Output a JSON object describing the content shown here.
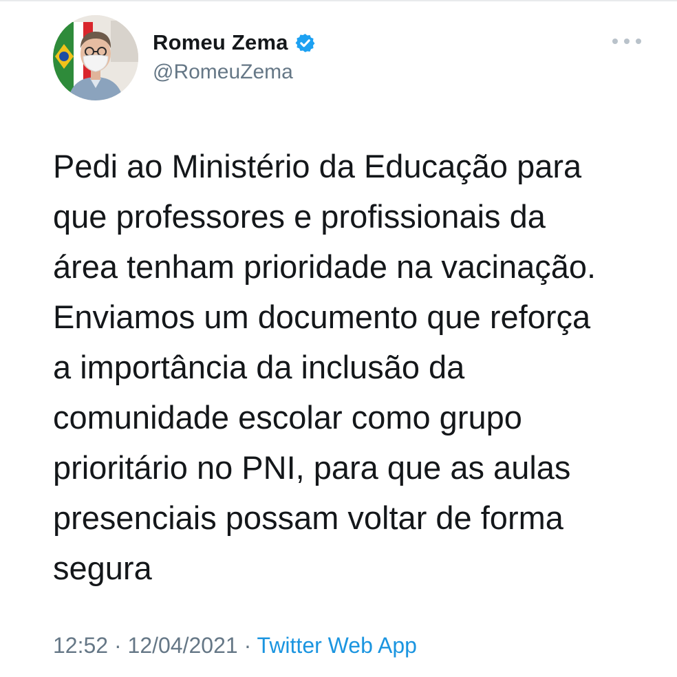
{
  "tweet": {
    "author": {
      "display_name": "Romeu Zema",
      "handle": "@RomeuZema",
      "verified": true,
      "avatar_icon": "profile-photo"
    },
    "more_icon": "more-horizontal-icon",
    "text": "Pedi ao Ministério da Educação para\nque professores e profissionais da\nárea tenham prioridade na vacinação.\nEnviamos um documento que reforça\na importância da inclusão da\ncomunidade escolar como grupo\nprioritário no PNI, para que as aulas\npresenciais possam voltar de forma\nsegura",
    "time": "12:52",
    "separator": " · ",
    "date": "12/04/2021",
    "source": "Twitter Web App"
  },
  "colors": {
    "text_primary": "#14171a",
    "text_secondary": "#657786",
    "link": "#1b95e0",
    "verified_badge": "#1da1f2"
  }
}
